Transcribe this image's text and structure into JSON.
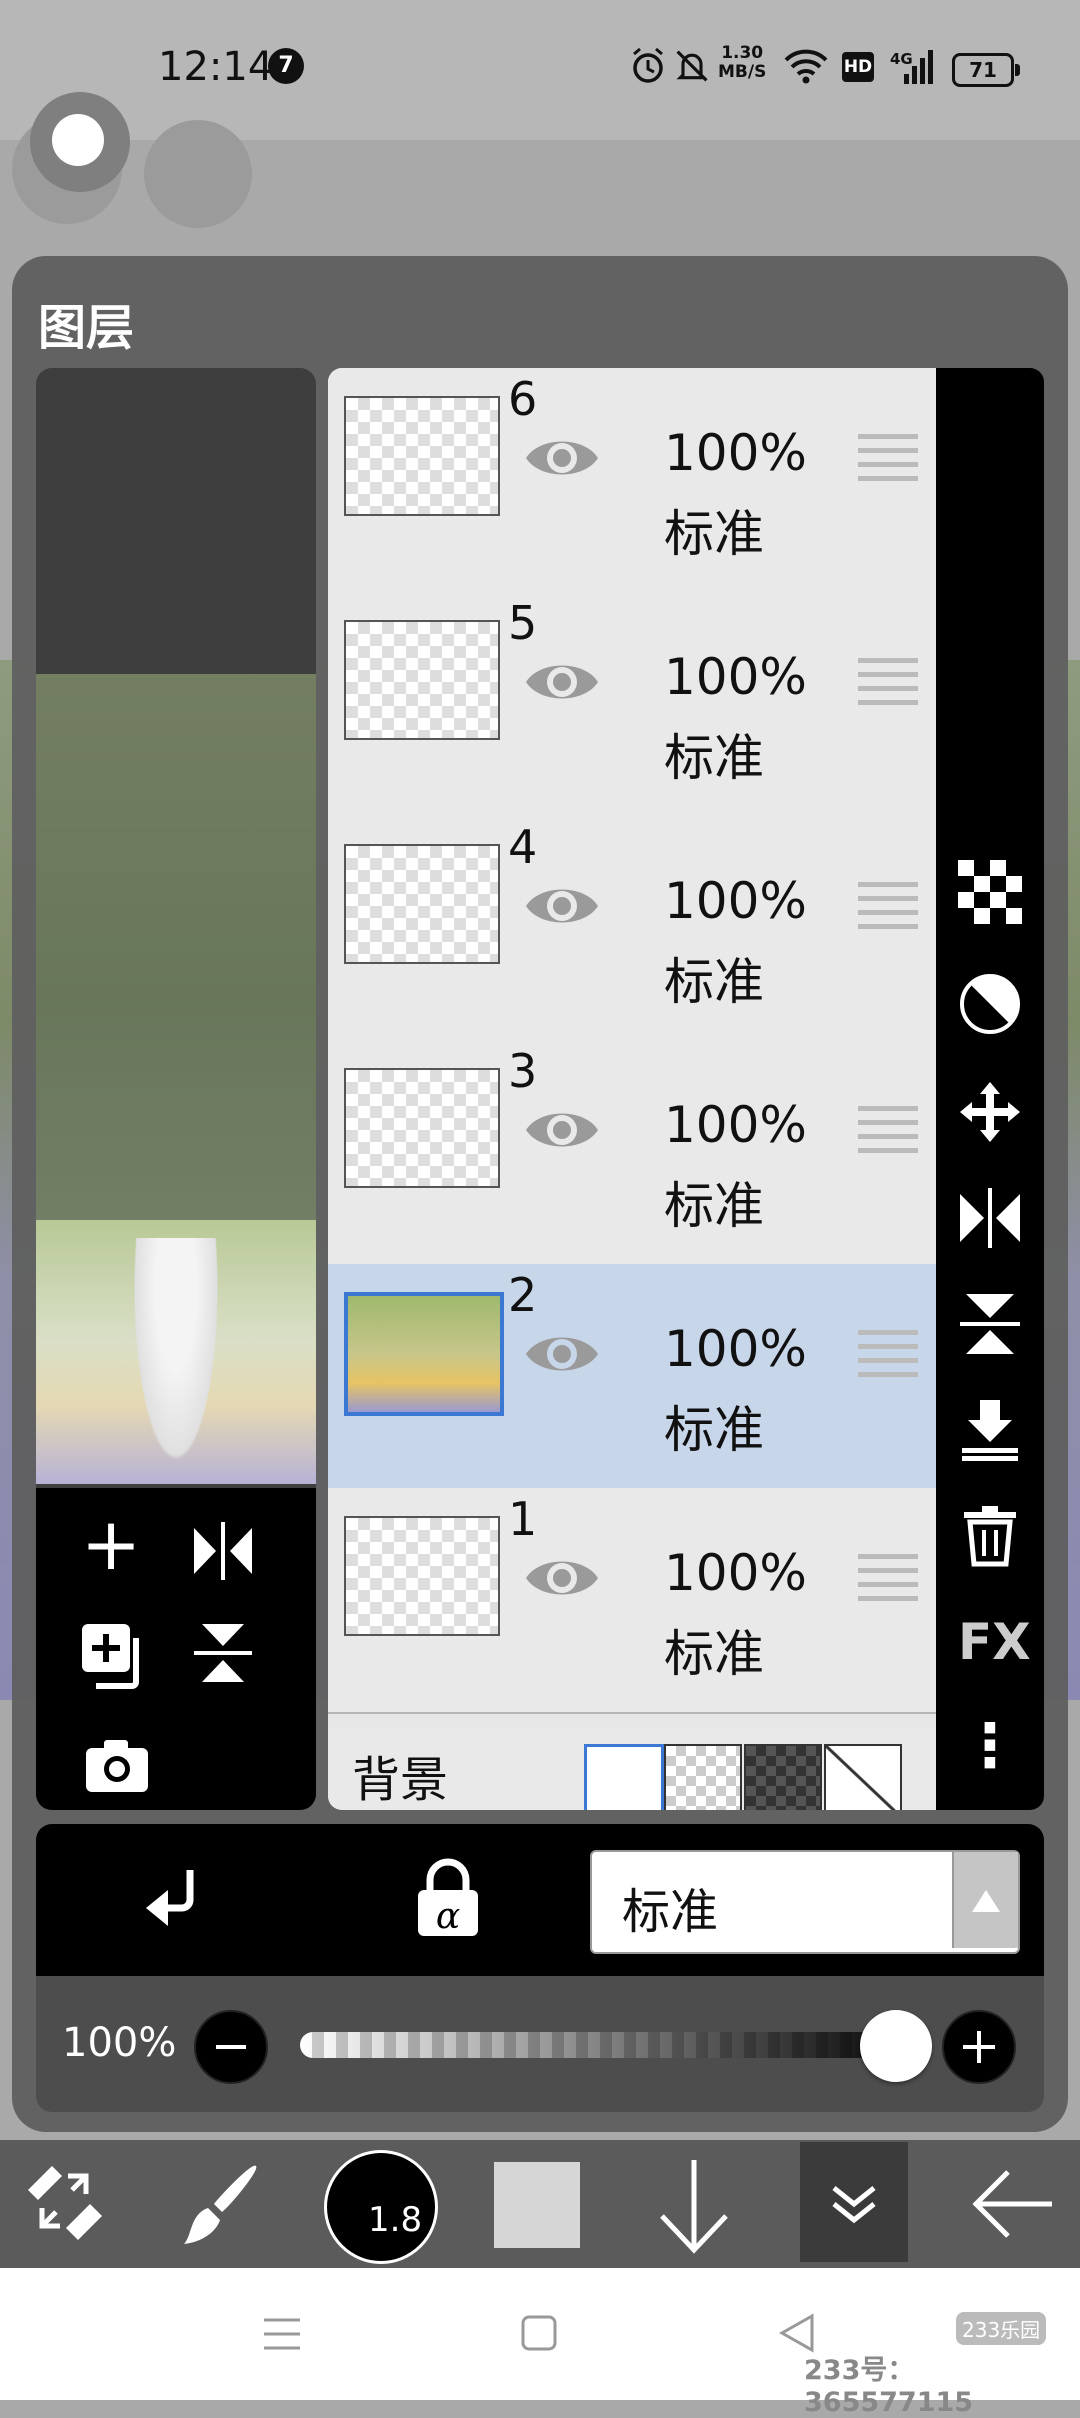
{
  "status": {
    "time": "12:14",
    "notification_count": "7",
    "net_speed_value": "1.30",
    "net_speed_unit": "MB/S",
    "network_type": "4G",
    "hd_badge": "HD",
    "battery": "71"
  },
  "panel": {
    "title": "图层"
  },
  "layers": [
    {
      "number": "6",
      "opacity": "100%",
      "mode": "标准",
      "selected": false
    },
    {
      "number": "5",
      "opacity": "100%",
      "mode": "标准",
      "selected": false
    },
    {
      "number": "4",
      "opacity": "100%",
      "mode": "标准",
      "selected": false
    },
    {
      "number": "3",
      "opacity": "100%",
      "mode": "标准",
      "selected": false
    },
    {
      "number": "2",
      "opacity": "100%",
      "mode": "标准",
      "selected": true
    },
    {
      "number": "1",
      "opacity": "100%",
      "mode": "标准",
      "selected": false
    }
  ],
  "background_row": {
    "label": "背景"
  },
  "right_toolbar": {
    "fx_label": "FX",
    "more_icon": "⋮"
  },
  "blend": {
    "mode_value": "标准"
  },
  "opacity": {
    "label": "100%",
    "value": 1.0
  },
  "bottom_toolbar": {
    "brush_size": "1.8"
  },
  "navbar": {
    "watermark": "233号：365577115",
    "watermark_logo": "233乐园"
  },
  "icons": [
    "clear-layer-icon",
    "transparency-icon",
    "move-icon",
    "flip-horizontal-icon",
    "flip-vertical-icon",
    "merge-down-icon",
    "delete-icon",
    "fx-icon",
    "more-icon",
    "add-layer-icon",
    "mirror-icon",
    "duplicate-layer-icon",
    "flip-icon",
    "camera-icon",
    "clip-icon",
    "alpha-lock-icon",
    "minus-icon",
    "plus-icon",
    "tool-transform-icon",
    "brush-icon",
    "arrow-down-icon",
    "chevron-double-down-icon",
    "back-arrow-icon",
    "menu-icon",
    "home-icon",
    "back-icon"
  ],
  "colors": {
    "selected_layer": "#c8d6ea",
    "selected_thumb_border": "#3a78d4",
    "panel_bg": "#606060"
  }
}
